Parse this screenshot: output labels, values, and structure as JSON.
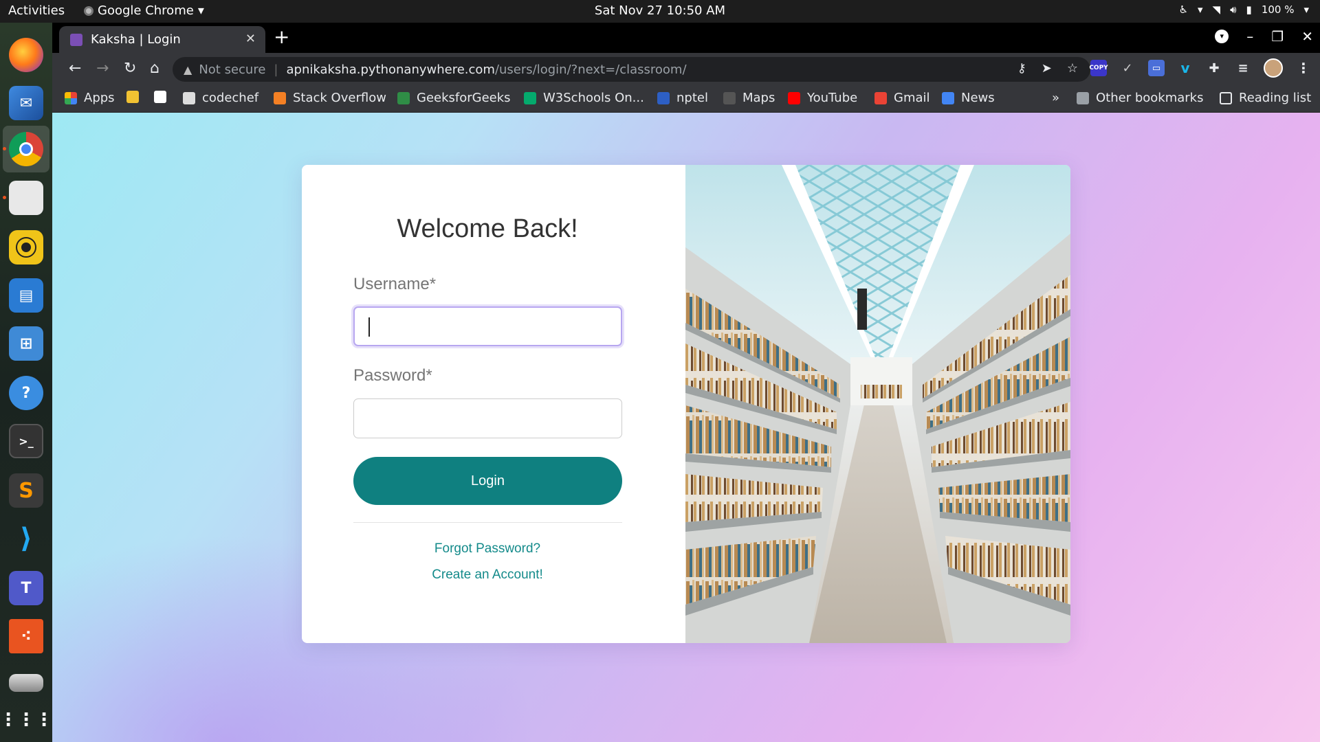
{
  "system": {
    "activities": "Activities",
    "app_name": "Google Chrome",
    "clock": "Sat Nov 27  10:50 AM",
    "battery": "100 %"
  },
  "browser": {
    "tab_title": "Kaksha | Login",
    "security": "Not secure",
    "url_host": "apnikaksha.pythonanywhere.com",
    "url_path": "/users/login/?next=/classroom/",
    "ext_badge": "COPY"
  },
  "bookmarks": {
    "apps": "Apps",
    "items": [
      "codechef",
      "Stack Overflow",
      "GeeksforGeeks",
      "W3Schools On...",
      "nptel",
      "Maps",
      "YouTube",
      "Gmail",
      "News"
    ],
    "more": "»",
    "other": "Other bookmarks",
    "reading_list": "Reading list"
  },
  "login": {
    "heading": "Welcome Back!",
    "username_label": "Username*",
    "username_value": "",
    "password_label": "Password*",
    "password_value": "",
    "submit": "Login",
    "forgot": "Forgot Password?",
    "create": "Create an Account!"
  },
  "colors": {
    "primary": "#0f8080",
    "link": "#138a8a",
    "focus_ring": "#b7a6f0"
  }
}
